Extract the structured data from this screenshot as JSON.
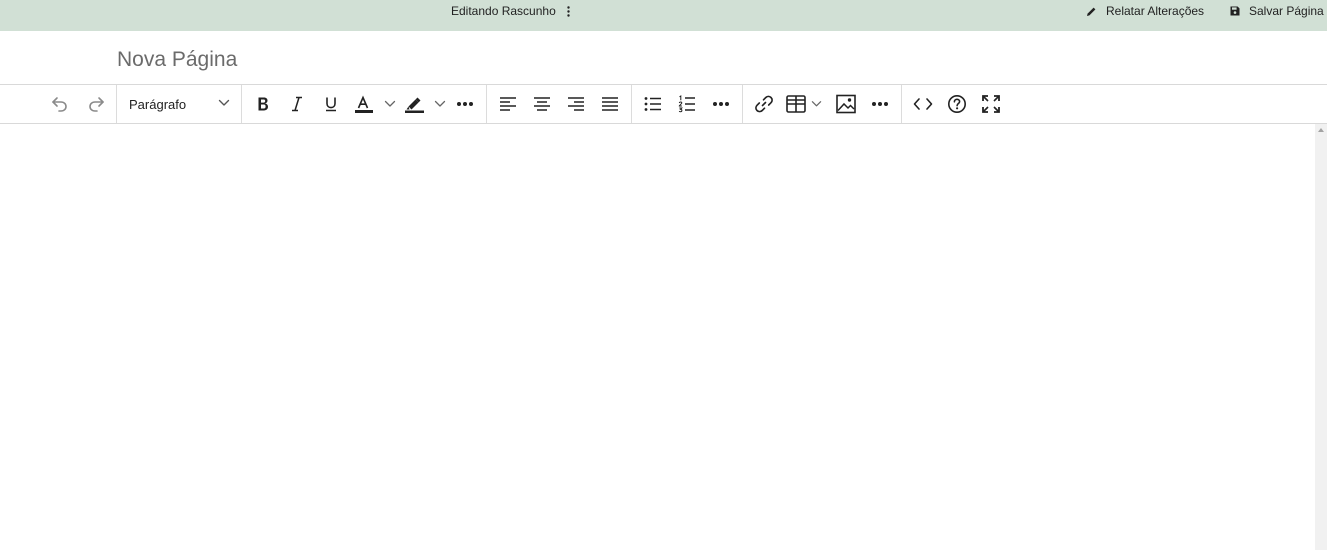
{
  "topbar": {
    "draft_label": "Editando Rascunho",
    "menu_icon": "vertical-dots-icon",
    "report_label": "Relatar Alterações",
    "report_icon": "pencil-icon",
    "save_label": "Salvar Página",
    "save_icon": "floppy-disk-icon",
    "background": "#d1e0d5"
  },
  "page": {
    "title_placeholder": "Nova Página",
    "title_value": ""
  },
  "toolbar": {
    "block_format": "Parágrafo",
    "buttons": [
      "undo",
      "redo",
      "bold",
      "italic",
      "underline",
      "text-color",
      "highlight-color",
      "more-formatting",
      "align-left",
      "align-center",
      "align-right",
      "align-justify",
      "bullet-list",
      "numbered-list",
      "more-lists",
      "link",
      "table",
      "image",
      "more-insert",
      "source-code",
      "help",
      "fullscreen"
    ]
  }
}
